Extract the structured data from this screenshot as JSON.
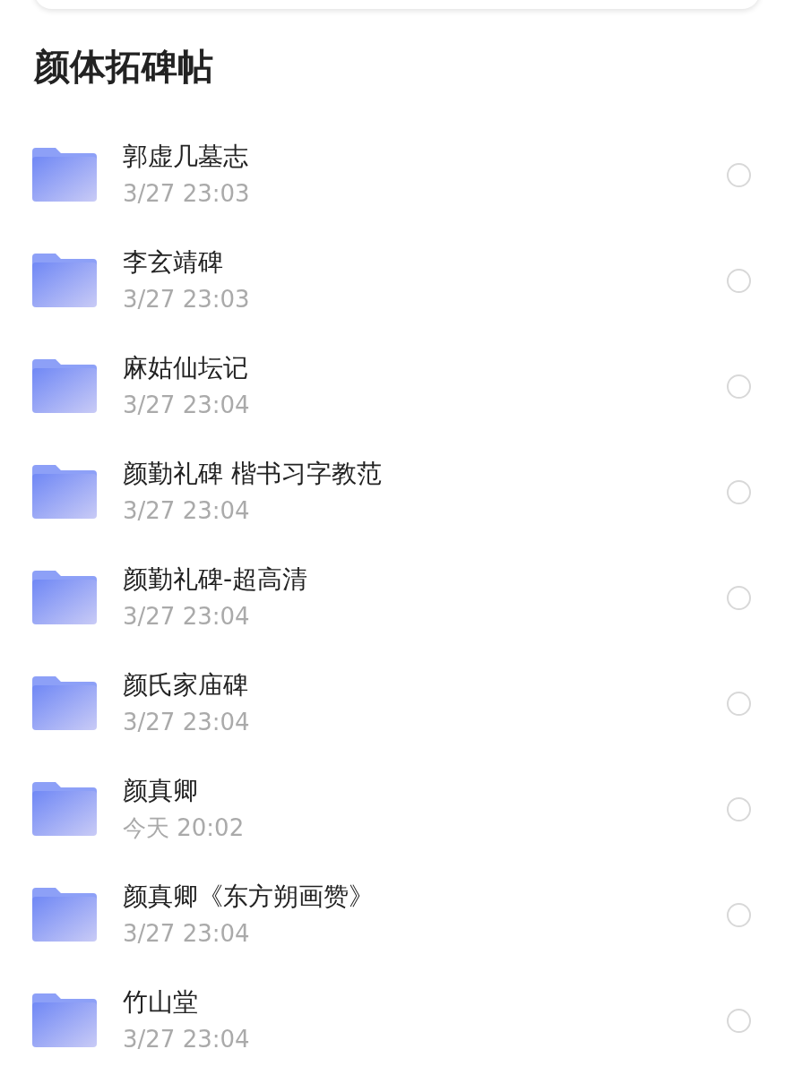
{
  "title": "颜体拓碑帖",
  "folders": [
    {
      "name": "郭虚几墓志",
      "time": "3/27 23:03",
      "selected": false
    },
    {
      "name": "李玄靖碑",
      "time": "3/27 23:03",
      "selected": false
    },
    {
      "name": "麻姑仙坛记",
      "time": "3/27 23:04",
      "selected": false
    },
    {
      "name": "颜勤礼碑 楷书习字教范",
      "time": "3/27 23:04",
      "selected": false
    },
    {
      "name": "颜勤礼碑-超高清",
      "time": "3/27 23:04",
      "selected": false
    },
    {
      "name": "颜氏家庙碑",
      "time": "3/27 23:04",
      "selected": false
    },
    {
      "name": "颜真卿",
      "time": "今天 20:02",
      "selected": false
    },
    {
      "name": "颜真卿《东方朔画赞》",
      "time": "3/27 23:04",
      "selected": false
    },
    {
      "name": "竹山堂",
      "time": "3/27 23:04",
      "selected": false
    }
  ]
}
